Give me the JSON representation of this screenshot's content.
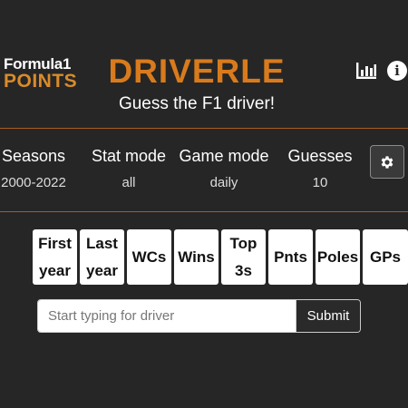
{
  "logo": {
    "line1": "Formula1",
    "line2": "POINTS"
  },
  "header": {
    "title": "DRIVERLE",
    "subtitle": "Guess the F1 driver!",
    "stats_icon": "bar-chart-icon",
    "info_icon": "info-icon",
    "info_glyph": "i"
  },
  "colors": {
    "accent": "#d97b1c",
    "background": "#262626",
    "divider": "#a85c20"
  },
  "settings": [
    {
      "label": "Seasons",
      "value": "2000-2022"
    },
    {
      "label": "Stat mode",
      "value": "all"
    },
    {
      "label": "Game mode",
      "value": "daily"
    },
    {
      "label": "Guesses",
      "value": "10"
    }
  ],
  "settings_button": {
    "icon": "gear-icon"
  },
  "columns": [
    {
      "line1": "First",
      "line2": "year"
    },
    {
      "line1": "Last",
      "line2": "year"
    },
    {
      "line1": "WCs",
      "line2": ""
    },
    {
      "line1": "Wins",
      "line2": ""
    },
    {
      "line1": "Top",
      "line2": "3s"
    },
    {
      "line1": "Pnts",
      "line2": ""
    },
    {
      "line1": "Poles",
      "line2": ""
    },
    {
      "line1": "GPs",
      "line2": ""
    }
  ],
  "guess_form": {
    "placeholder": "Start typing for driver",
    "value": "",
    "submit_label": "Submit"
  }
}
